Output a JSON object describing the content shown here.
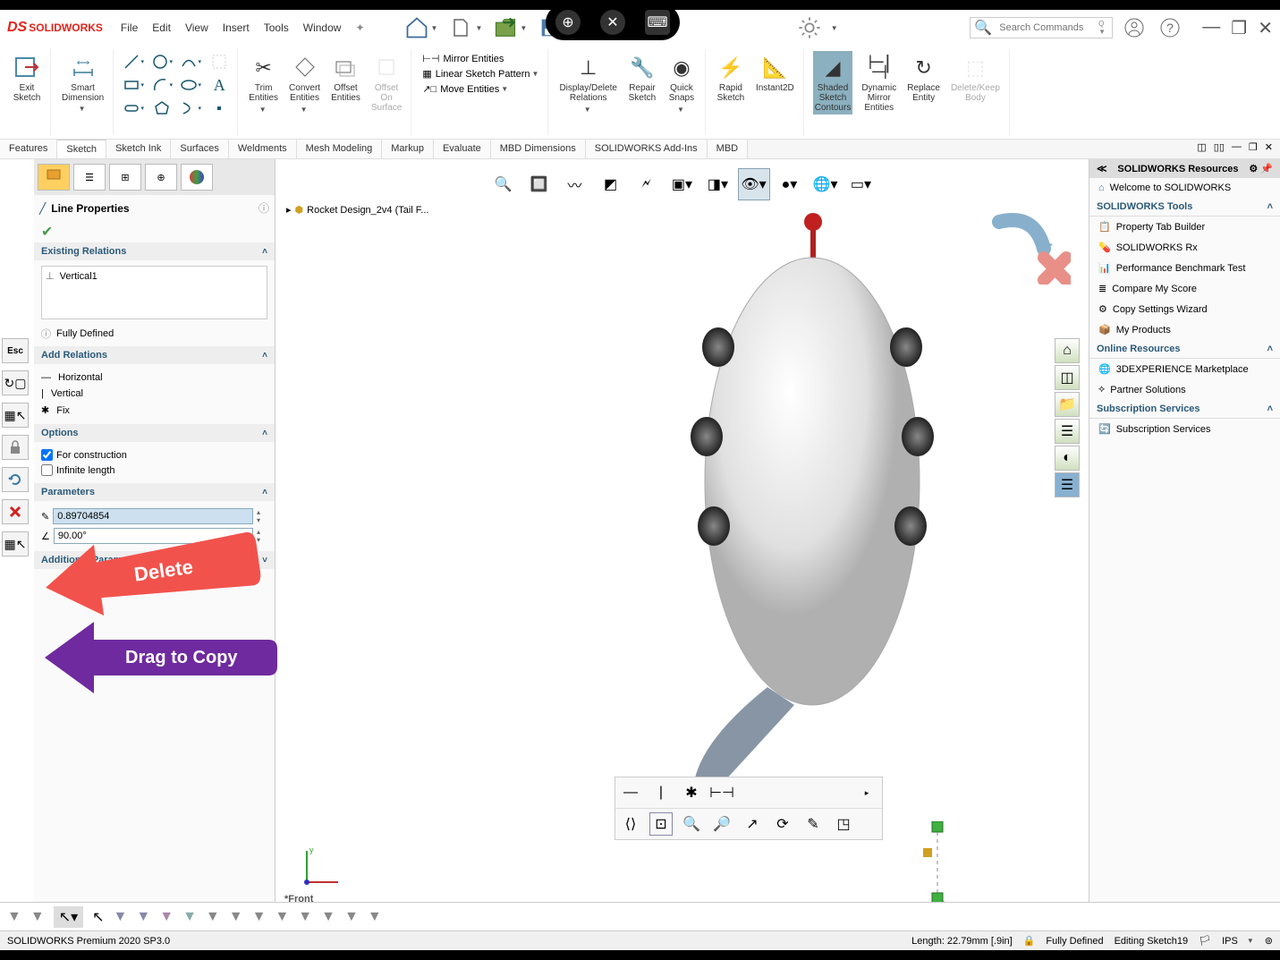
{
  "app": {
    "brand": "SOLIDWORKS"
  },
  "main_menu": [
    "File",
    "Edit",
    "View",
    "Insert",
    "Tools",
    "Window"
  ],
  "search": {
    "placeholder": "Search Commands"
  },
  "ribbon": {
    "exit_sketch": "Exit\nSketch",
    "smart_dimension": "Smart\nDimension",
    "trim": "Trim\nEntities",
    "convert": "Convert\nEntities",
    "offset": "Offset\nEntities",
    "offset_surface": "Offset\nOn\nSurface",
    "mirror": "Mirror Entities",
    "linear_pattern": "Linear Sketch Pattern",
    "move": "Move Entities",
    "display_relations": "Display/Delete\nRelations",
    "repair": "Repair\nSketch",
    "quick_snaps": "Quick\nSnaps",
    "rapid": "Rapid\nSketch",
    "instant2d": "Instant2D",
    "shaded": "Shaded\nSketch\nContours",
    "dynamic_mirror": "Dynamic\nMirror\nEntities",
    "replace": "Replace\nEntity",
    "delete_keep": "Delete/Keep\nBody"
  },
  "cmd_tabs": [
    "Features",
    "Sketch",
    "Sketch Ink",
    "Surfaces",
    "Weldments",
    "Mesh Modeling",
    "Markup",
    "Evaluate",
    "MBD Dimensions",
    "SOLIDWORKS Add-Ins",
    "MBD"
  ],
  "cmd_active": "Sketch",
  "prop": {
    "title": "Line Properties",
    "existing_relations_header": "Existing Relations",
    "relations": [
      "Vertical1"
    ],
    "status": "Fully Defined",
    "add_relations_header": "Add Relations",
    "add_relations": [
      "Horizontal",
      "Vertical",
      "Fix"
    ],
    "options_header": "Options",
    "for_construction": "For construction",
    "for_construction_checked": true,
    "infinite_length": "Infinite length",
    "infinite_length_checked": false,
    "parameters_header": "Parameters",
    "param_length": "0.89704854",
    "param_angle": "90.00°",
    "additional_parameters_header": "Additional Parameters"
  },
  "breadcrumb": "Rocket Design_2v4  (Tail F...",
  "right_panel": {
    "header": "SOLIDWORKS Resources",
    "welcome": "Welcome to SOLIDWORKS",
    "tools_header": "SOLIDWORKS Tools",
    "tools": [
      "Property Tab Builder",
      "SOLIDWORKS Rx",
      "Performance Benchmark Test",
      "Compare My Score",
      "Copy Settings Wizard",
      "My Products"
    ],
    "online_header": "Online Resources",
    "online": [
      "3DEXPERIENCE Marketplace",
      "Partner Solutions"
    ],
    "subscription_header": "Subscription Services",
    "subscription": [
      "Subscription Services"
    ]
  },
  "callouts": {
    "delete": "Delete",
    "drag": "Drag to Copy"
  },
  "view_name": "*Front",
  "status": {
    "product": "SOLIDWORKS Premium 2020 SP3.0",
    "length": "Length: 22.79mm [.9in]",
    "defined": "Fully Defined",
    "editing": "Editing Sketch19",
    "units": "IPS"
  }
}
